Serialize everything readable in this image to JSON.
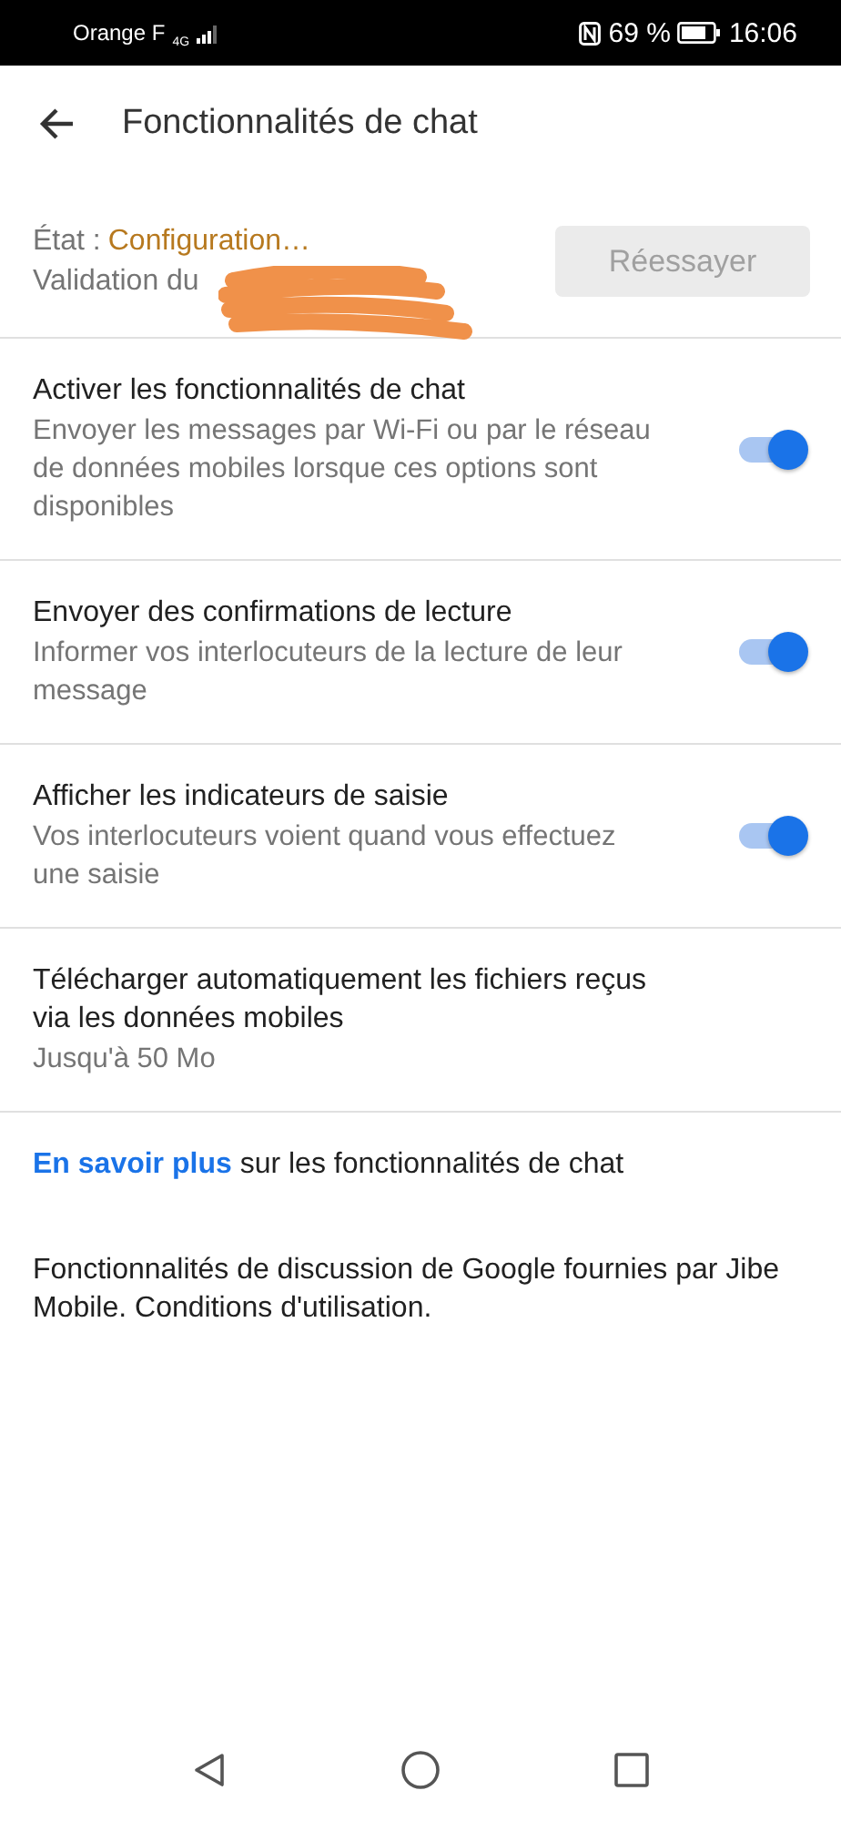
{
  "status_bar": {
    "carrier": "Orange F",
    "network": "4G",
    "battery": "69 %",
    "time": "16:06"
  },
  "app_bar": {
    "title": "Fonctionnalités de chat"
  },
  "status": {
    "label": "État :",
    "value": "Configuration…",
    "detail": "Validation du",
    "redacted": true,
    "button": {
      "label": "Réessayer",
      "disabled": true
    }
  },
  "settings": [
    {
      "title": "Activer les fonctionnalités de chat",
      "summary": "Envoyer les messages par Wi-Fi ou par le réseau de données mobiles lorsque ces options sont disponibles",
      "kind": "switch",
      "on": true
    },
    {
      "title": "Envoyer des confirmations de lecture",
      "summary": "Informer vos interlocuteurs de la lecture de leur message",
      "kind": "switch",
      "on": true
    },
    {
      "title": "Afficher les indicateurs de saisie",
      "summary": "Vos interlocuteurs voient quand vous effectuez une saisie",
      "kind": "switch",
      "on": true
    },
    {
      "title": "Télécharger automatiquement les fichiers reçus via les données mobiles",
      "summary": "Jusqu'à 50 Mo",
      "kind": "plain"
    }
  ],
  "learn_more": {
    "link": "En savoir plus",
    "text": "sur les fonctionnalités de chat"
  },
  "footer": "Fonctionnalités de discussion de Google fournies par Jibe Mobile. Conditions d'utilisation."
}
